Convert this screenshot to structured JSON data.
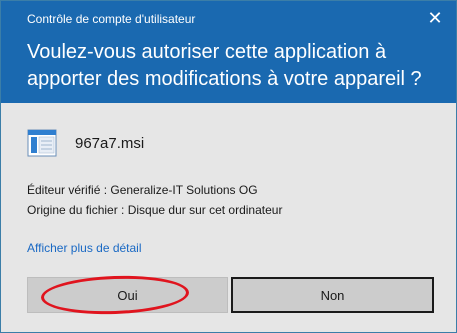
{
  "window": {
    "caption": "Contrôle de compte d'utilisateur",
    "close_glyph": "✕"
  },
  "prompt": {
    "question": "Voulez-vous autoriser cette application à apporter des modifications à votre appareil ?"
  },
  "app": {
    "name": "967a7.msi",
    "icon": "installer-package-icon"
  },
  "details": {
    "publisher": "Éditeur vérifié : Generalize-IT Solutions OG",
    "origin": "Origine du fichier : Disque dur sur cet ordinateur"
  },
  "links": {
    "more_details": "Afficher plus de détail"
  },
  "buttons": {
    "yes": "Oui",
    "no": "Non"
  },
  "colors": {
    "header": "#1a69b0",
    "body": "#e6e6e6",
    "link": "#1a69c4",
    "highlight_annotation": "#e0141e"
  }
}
